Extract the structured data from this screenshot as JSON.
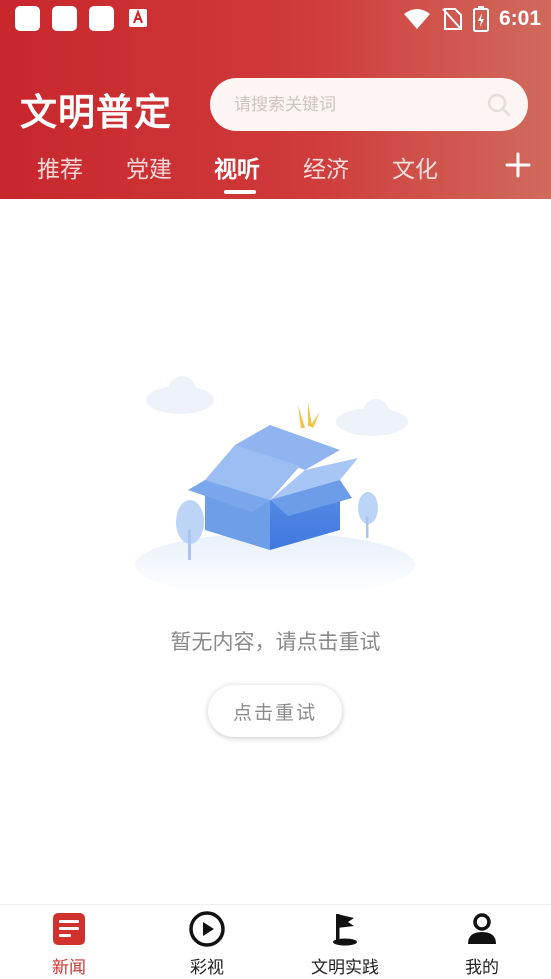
{
  "status_bar": {
    "time": "6:01"
  },
  "header": {
    "app_title": "文明普定",
    "search_placeholder": "请搜索关键词"
  },
  "tabs": [
    {
      "label": "推荐"
    },
    {
      "label": "党建"
    },
    {
      "label": "视听",
      "active": true
    },
    {
      "label": "经济"
    },
    {
      "label": "文化"
    }
  ],
  "empty_state": {
    "message": "暂无内容，请点击重试",
    "retry_label": "点击重试"
  },
  "bottom_nav": [
    {
      "label": "新闻",
      "icon": "news-icon",
      "active": true
    },
    {
      "label": "彩视",
      "icon": "play-circle-icon"
    },
    {
      "label": "文明实践",
      "icon": "flag-icon"
    },
    {
      "label": "我的",
      "icon": "user-icon"
    }
  ],
  "colors": {
    "brand_red": "#c8272c",
    "active_nav": "#d0312d",
    "illustration_blue": "#6f9ee8"
  }
}
